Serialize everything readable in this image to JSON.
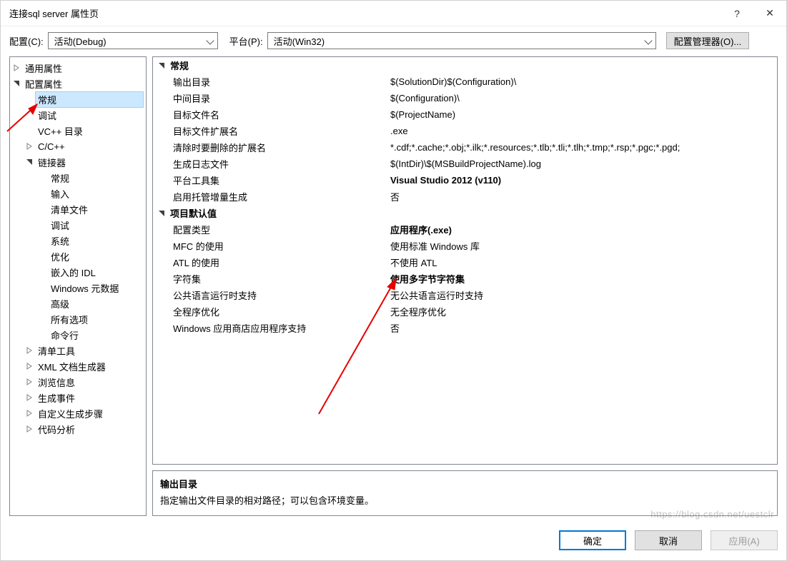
{
  "titlebar": {
    "title": "连接sql server 属性页",
    "helpGlyph": "?",
    "closeGlyph": "✕"
  },
  "configbar": {
    "configLabel": "配置(C):",
    "configValue": "活动(Debug)",
    "platformLabel": "平台(P):",
    "platformValue": "活动(Win32)",
    "managerBtn": "配置管理器(O)..."
  },
  "tree": {
    "items": [
      {
        "depth": 0,
        "expander": "closed",
        "label": "通用属性"
      },
      {
        "depth": 0,
        "expander": "open",
        "label": "配置属性"
      },
      {
        "depth": 1,
        "expander": "none",
        "label": "常规",
        "selected": true
      },
      {
        "depth": 1,
        "expander": "none",
        "label": "调试"
      },
      {
        "depth": 1,
        "expander": "none",
        "label": "VC++ 目录"
      },
      {
        "depth": 1,
        "expander": "closed",
        "label": "C/C++"
      },
      {
        "depth": 1,
        "expander": "open",
        "label": "链接器"
      },
      {
        "depth": 2,
        "expander": "none",
        "label": "常规"
      },
      {
        "depth": 2,
        "expander": "none",
        "label": "输入"
      },
      {
        "depth": 2,
        "expander": "none",
        "label": "清单文件"
      },
      {
        "depth": 2,
        "expander": "none",
        "label": "调试"
      },
      {
        "depth": 2,
        "expander": "none",
        "label": "系统"
      },
      {
        "depth": 2,
        "expander": "none",
        "label": "优化"
      },
      {
        "depth": 2,
        "expander": "none",
        "label": "嵌入的 IDL"
      },
      {
        "depth": 2,
        "expander": "none",
        "label": "Windows 元数据"
      },
      {
        "depth": 2,
        "expander": "none",
        "label": "高级"
      },
      {
        "depth": 2,
        "expander": "none",
        "label": "所有选项"
      },
      {
        "depth": 2,
        "expander": "none",
        "label": "命令行"
      },
      {
        "depth": 1,
        "expander": "closed",
        "label": "清单工具"
      },
      {
        "depth": 1,
        "expander": "closed",
        "label": "XML 文档生成器"
      },
      {
        "depth": 1,
        "expander": "closed",
        "label": "浏览信息"
      },
      {
        "depth": 1,
        "expander": "closed",
        "label": "生成事件"
      },
      {
        "depth": 1,
        "expander": "closed",
        "label": "自定义生成步骤"
      },
      {
        "depth": 1,
        "expander": "closed",
        "label": "代码分析"
      }
    ]
  },
  "groups": [
    {
      "title": "常规",
      "rows": [
        {
          "key": "输出目录",
          "value": "$(SolutionDir)$(Configuration)\\"
        },
        {
          "key": "中间目录",
          "value": "$(Configuration)\\"
        },
        {
          "key": "目标文件名",
          "value": "$(ProjectName)"
        },
        {
          "key": "目标文件扩展名",
          "value": ".exe"
        },
        {
          "key": "清除时要删除的扩展名",
          "value": "*.cdf;*.cache;*.obj;*.ilk;*.resources;*.tlb;*.tli;*.tlh;*.tmp;*.rsp;*.pgc;*.pgd;"
        },
        {
          "key": "生成日志文件",
          "value": "$(IntDir)\\$(MSBuildProjectName).log"
        },
        {
          "key": "平台工具集",
          "value": "Visual Studio 2012 (v110)",
          "bold": true
        },
        {
          "key": "启用托管增量生成",
          "value": "否"
        }
      ]
    },
    {
      "title": "项目默认值",
      "rows": [
        {
          "key": "配置类型",
          "value": "应用程序(.exe)",
          "bold": true
        },
        {
          "key": "MFC 的使用",
          "value": "使用标准 Windows 库"
        },
        {
          "key": "ATL 的使用",
          "value": "不使用 ATL"
        },
        {
          "key": "字符集",
          "value": "使用多字节字符集",
          "bold": true
        },
        {
          "key": "公共语言运行时支持",
          "value": "无公共语言运行时支持"
        },
        {
          "key": "全程序优化",
          "value": "无全程序优化"
        },
        {
          "key": "Windows 应用商店应用程序支持",
          "value": "否"
        }
      ]
    }
  ],
  "desc": {
    "title": "输出目录",
    "text": "指定输出文件目录的相对路径；可以包含环境变量。"
  },
  "footer": {
    "ok": "确定",
    "cancel": "取消",
    "apply": "应用(A)"
  },
  "watermark": "https://blog.csdn.net/uestclr"
}
